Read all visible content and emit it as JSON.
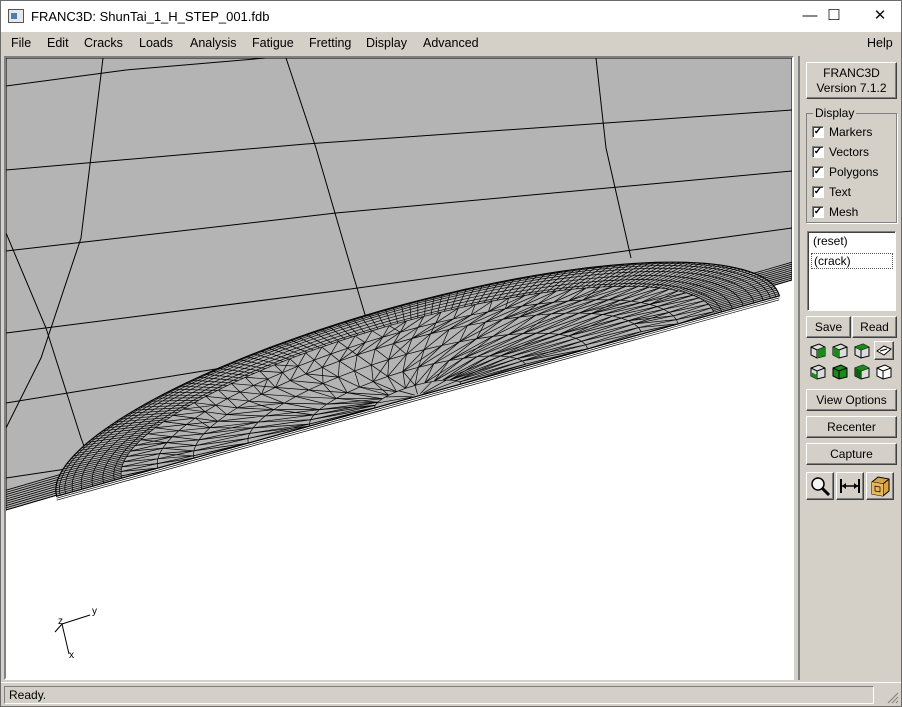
{
  "window": {
    "title": "FRANC3D:  ShunTai_1_H_STEP_001.fdb",
    "min_glyph": "—",
    "max_glyph": "☐",
    "close_glyph": "✕"
  },
  "menu": {
    "items": [
      "File",
      "Edit",
      "Cracks",
      "Loads",
      "Analysis",
      "Fatigue",
      "Fretting",
      "Display",
      "Advanced"
    ],
    "help": "Help"
  },
  "version": {
    "name": "FRANC3D",
    "version": "Version 7.1.2"
  },
  "display": {
    "legend": "Display",
    "options": [
      {
        "label": "Markers",
        "checked": true
      },
      {
        "label": "Vectors",
        "checked": true
      },
      {
        "label": "Polygons",
        "checked": true
      },
      {
        "label": "Text",
        "checked": true
      },
      {
        "label": "Mesh",
        "checked": true
      }
    ]
  },
  "views": {
    "items": [
      "(reset)",
      "(crack)"
    ],
    "selected_index": 1
  },
  "buttons": {
    "save": "Save",
    "read": "Read",
    "view_options": "View Options",
    "recenter": "Recenter",
    "capture": "Capture"
  },
  "view_icons": [
    "view-iso-icon",
    "view-front-icon",
    "view-side-icon",
    "view-top-icon",
    "view-bottom-icon",
    "view-back-icon",
    "view-right-icon",
    "view-wire-icon"
  ],
  "tool_icons": [
    "zoom-icon",
    "measure-icon",
    "cube-icon"
  ],
  "axes": {
    "x": "x",
    "y": "y",
    "z": "z"
  },
  "status": {
    "text": "Ready."
  },
  "colors": {
    "model_face": "#b4b4b4",
    "mesh_line": "#000000",
    "background": "#ffffff",
    "icon_green": "#1a8a1a"
  }
}
